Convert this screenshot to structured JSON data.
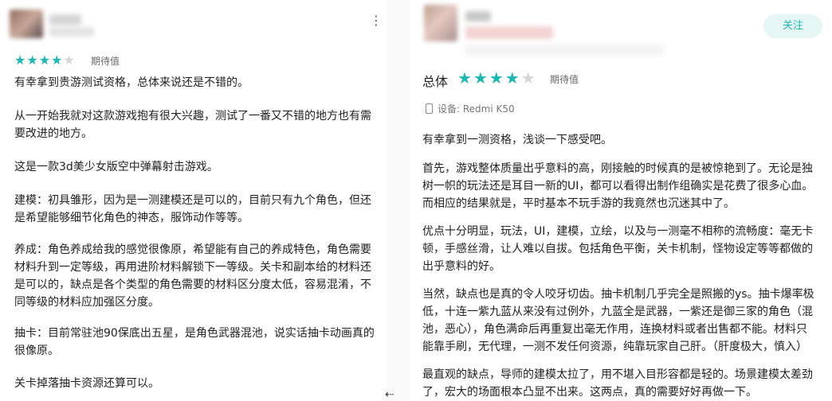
{
  "colors": {
    "accent": "#19b8b2",
    "follow_bg": "#e6f6f5",
    "star_empty": "#d5d5d5"
  },
  "left_review": {
    "stars_filled": 4,
    "stars_total": 5,
    "rating_label": "期待值",
    "paragraphs": [
      "有幸拿到贵游测试资格，总体来说还是不错的。",
      "从一开始我就对这款游戏抱有很大兴趣，测试了一番又不错的地方也有需\n要改进的地方。",
      "这是一款3d美少女版空中弹幕射击游戏。",
      "建模：初具雏形，因为是一测建模还是可以的，目前只有九个角色，但还\n是希望能够细节化角色的神态，服饰动作等等。",
      "养成：角色养成给我的感觉很像原，希望能有自己的养成特色，角色需要\n材料升到一定等级，再用进阶材料解锁下一等级。关卡和副本给的材料还\n是可以的，缺点是各个类型的角色需要的材料区分度太低，容易混淆，不\n同等级的材料应加强区分度。",
      "抽卡：目前常驻池90保底出五星，是角色武器混池，说实话抽卡动画真的\n很像原。",
      "关卡掉落抽卡资源还算可以。"
    ]
  },
  "right_review": {
    "follow_label": "关注",
    "overall_label": "总体",
    "stars_filled": 4,
    "stars_total": 5,
    "rating_label": "期待值",
    "device_label": "设备:  Redmi K50",
    "paragraphs": [
      "有幸拿到一测资格，浅谈一下感受吧。",
      "首先，游戏整体质量出乎意料的高，刚接触的时候真的是被惊艳到了。无论是独\n树一帜的玩法还是耳目一新的UI，都可以看得出制作组确实是花费了很多心血。\n而相应的结果就是，平时基本不玩手游的我竟然也沉迷其中了。",
      "优点十分明显，玩法，UI，建模，立绘，以及与一测毫不相称的流畅度：毫无卡\n顿，手感丝滑，让人难以自拔。包括角色平衡，关卡机制，怪物设定等等都做的\n出乎意料的好。",
      "当然，缺点也是真的令人咬牙切齿。抽卡机制几乎完全是照搬的ys。抽卡爆率极\n低，十连一紫九蓝从来没有过例外，九蓝全是武器，一紫还是御三家的角色（混\n池，恶心），角色满命后再重复出毫无作用，连换材料或者出售都不能。材料只\n能靠手刷，无代理，一测不发任何资源，纯靠玩家自己肝。（肝度极大，慎入）",
      "最直观的缺点，导师的建模太拉了，用不堪入目形容都是轻的。场景建模太差劲\n了，宏大的场面根本凸显不出来。这两点，真的需要好好再做一下。"
    ]
  }
}
